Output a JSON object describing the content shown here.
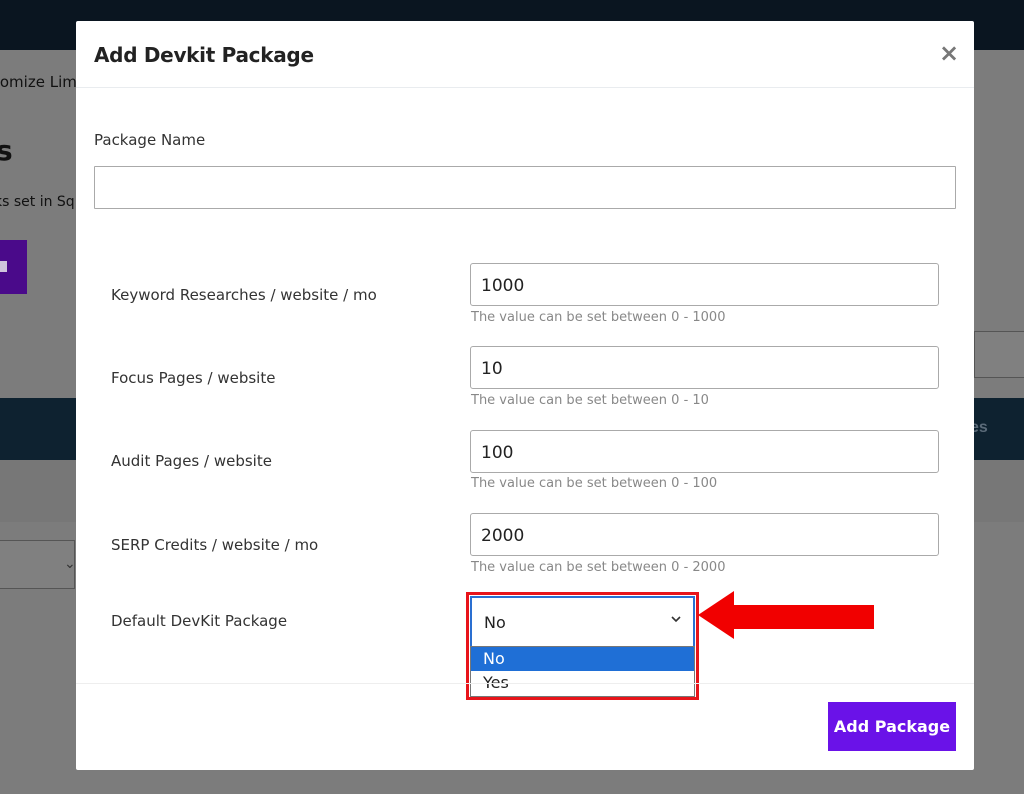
{
  "background": {
    "tab_text": "tomize Lim",
    "heading": "s",
    "subtext": "ks set in Sq",
    "band_text": "es"
  },
  "modal": {
    "title": "Add Devkit Package",
    "close_glyph": "×",
    "package_name_label": "Package Name",
    "package_name_value": "",
    "fields": [
      {
        "label": "Keyword Researches / website / mo",
        "value": "1000",
        "help": "The value can be set between 0 - 1000"
      },
      {
        "label": "Focus Pages / website",
        "value": "10",
        "help": "The value can be set between 0 - 10"
      },
      {
        "label": "Audit Pages / website",
        "value": "100",
        "help": "The value can be set between 0 - 100"
      },
      {
        "label": "SERP Credits / website / mo",
        "value": "2000",
        "help": "The value can be set between 0 - 2000"
      }
    ],
    "default_label": "Default DevKit Package",
    "default_selected": "No",
    "default_options": [
      "No",
      "Yes"
    ],
    "submit_label": "Add Package"
  },
  "colors": {
    "accent": "#6a12e8",
    "highlight": "#e8141a",
    "option_selected": "#1f6fd6"
  }
}
